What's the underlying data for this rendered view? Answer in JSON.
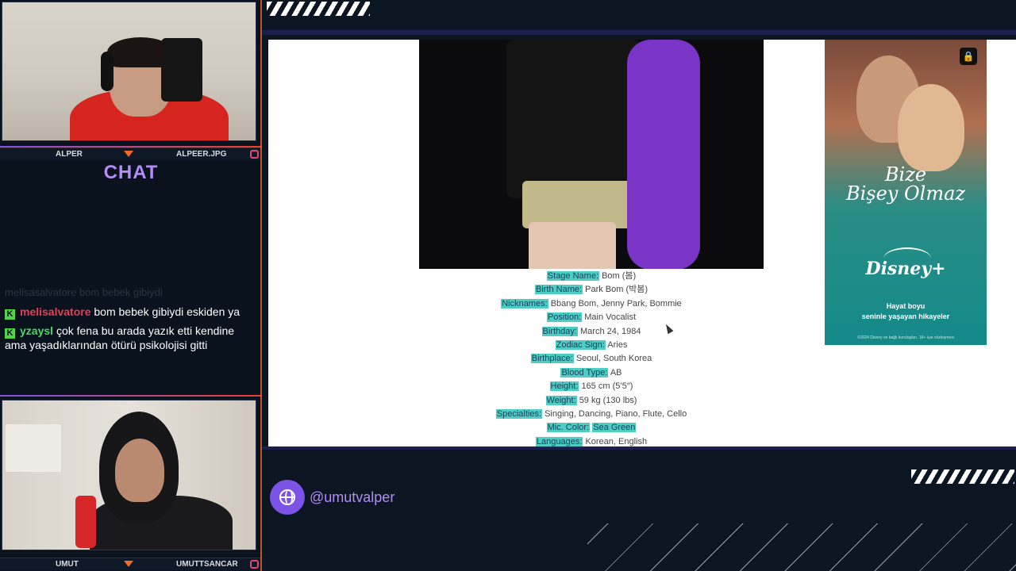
{
  "top_cam": {
    "left_name": "ALPER",
    "right_name": "ALPEER.JPG"
  },
  "bottom_cam": {
    "left_name": "UMUT",
    "right_name": "UMUTTSANCAR"
  },
  "chat": {
    "title": "CHAT",
    "faded_line": "melisasalvatore bom bebek gibiydi",
    "messages": [
      {
        "user": "melisalvatore",
        "text": "bom bebek gibiydi eskiden ya",
        "user_color": "#e0405a"
      },
      {
        "user": "yzaysl",
        "text": "çok fena bu arada yazık etti kendine ama yaşadıklarından ötürü psikolojisi gitti",
        "user_color": "#4fd46c"
      }
    ]
  },
  "profile": {
    "rows": [
      {
        "key": "Stage Name:",
        "value": "Bom (봄)"
      },
      {
        "key": "Birth Name:",
        "value": "Park Bom (박봄)"
      },
      {
        "key": "Nicknames:",
        "value": "Bbang Bom, Jenny Park, Bommie"
      },
      {
        "key": "Position:",
        "value": "Main Vocalist"
      },
      {
        "key": "Birthday:",
        "value": "March 24, 1984"
      },
      {
        "key": "Zodiac Sign:",
        "value": "Aries"
      },
      {
        "key": "Birthplace:",
        "value": "Seoul, South Korea"
      },
      {
        "key": "Blood Type:",
        "value": "AB"
      },
      {
        "key": "Height:",
        "value": "165 cm (5’5″)"
      },
      {
        "key": "Weight:",
        "value": "59 kg (130 lbs)"
      },
      {
        "key": "Specialties:",
        "value": "Singing, Dancing, Piano, Flute, Cello"
      },
      {
        "key": "Mic. Color:",
        "value": "Sea Green"
      },
      {
        "key": "Languages:",
        "value": "Korean, English"
      }
    ]
  },
  "ad": {
    "title_line1": "Bize",
    "title_line2": "Bişey Olmaz",
    "logo": "Disney+",
    "tagline_line1": "Hayat boyu",
    "tagline_line2": "seninle yaşayan hikayeler",
    "fine_print": "©2024 Disney ve bağlı kuruluşları. 18+ üye sözleşmesi"
  },
  "handle": "@umutvalper",
  "colors": {
    "accent_purple": "#b48cf7",
    "highlight_teal": "#4ecdc4",
    "accent_orange": "#e8672e"
  }
}
